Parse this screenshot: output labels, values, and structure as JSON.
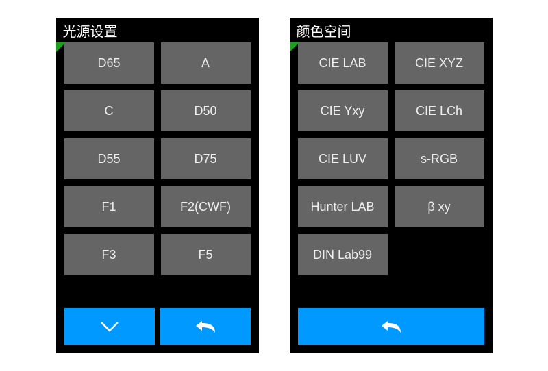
{
  "left": {
    "title": "光源设置",
    "options": [
      "D65",
      "A",
      "C",
      "D50",
      "D55",
      "D75",
      "F1",
      "F2(CWF)",
      "F3",
      "F5"
    ],
    "footer": {
      "down_icon": "chevron-down",
      "back_icon": "back-arrow"
    }
  },
  "right": {
    "title": "颜色空间",
    "options": [
      "CIE LAB",
      "CIE XYZ",
      "CIE Yxy",
      "CIE LCh",
      "CIE LUV",
      "s-RGB",
      "Hunter LAB",
      "β xy",
      "DIN Lab99"
    ],
    "footer": {
      "back_icon": "back-arrow"
    }
  },
  "colors": {
    "accent": "#0099ff",
    "button": "#656565",
    "corner": "#1aa01a"
  }
}
